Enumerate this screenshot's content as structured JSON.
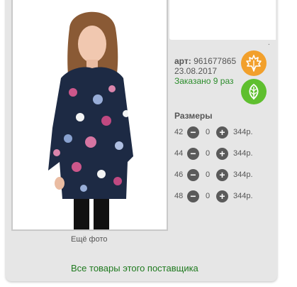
{
  "product": {
    "article_label": "арт:",
    "article_value": "961677865",
    "date": "23.08.2017",
    "ordered": "Заказано 9 раз"
  },
  "season_icons": {
    "autumn": "maple-leaf-icon",
    "spring": "leaf-icon"
  },
  "sizes": {
    "title": "Размеры",
    "rows": [
      {
        "size": "42",
        "qty": "0",
        "price": "344р."
      },
      {
        "size": "44",
        "qty": "0",
        "price": "344р."
      },
      {
        "size": "46",
        "qty": "0",
        "price": "344р."
      },
      {
        "size": "48",
        "qty": "0",
        "price": "344р."
      }
    ]
  },
  "photo": {
    "more_label": "Ещё фото"
  },
  "supplier": {
    "all_goods_label": "Все товары этого поставщика"
  },
  "misc": {
    "dot": "."
  },
  "colors": {
    "ordered": "#2c8d2c",
    "autumn": "#f2a02c",
    "spring": "#5fbf2f",
    "link": "#1f7a1f"
  }
}
